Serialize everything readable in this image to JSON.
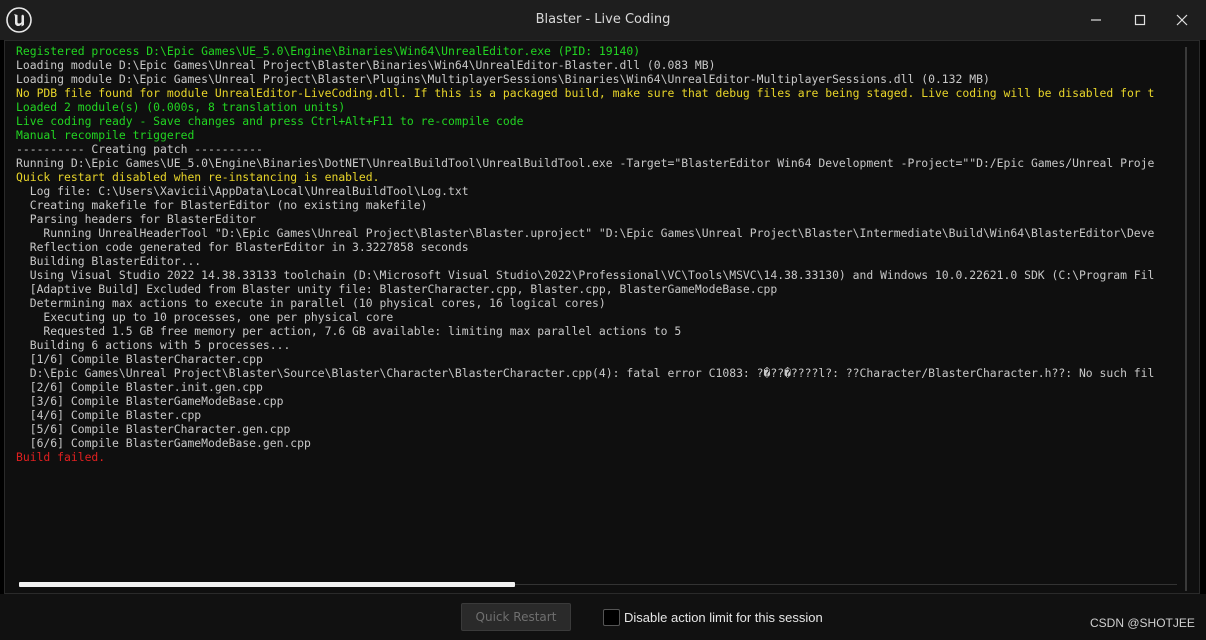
{
  "window": {
    "title": "Blaster - Live Coding"
  },
  "colors": {
    "green": "#22d422",
    "yellow": "#e8d52a",
    "gray": "#c8c8c8",
    "red": "#e02020"
  },
  "icons": {
    "logo": "unreal-engine-logo-icon",
    "minimize": "minimize-icon",
    "maximize": "maximize-icon",
    "close": "close-icon"
  },
  "console": {
    "lines": [
      {
        "text": "Registered process D:\\Epic Games\\UE_5.0\\Engine\\Binaries\\Win64\\UnrealEditor.exe (PID: 19140)",
        "color": "#22d422"
      },
      {
        "text": "Loading module D:\\Epic Games\\Unreal Project\\Blaster\\Binaries\\Win64\\UnrealEditor-Blaster.dll (0.083 MB)",
        "color": "#c8c8c8"
      },
      {
        "text": "Loading module D:\\Epic Games\\Unreal Project\\Blaster\\Plugins\\MultiplayerSessions\\Binaries\\Win64\\UnrealEditor-MultiplayerSessions.dll (0.132 MB)",
        "color": "#c8c8c8"
      },
      {
        "text": "No PDB file found for module UnrealEditor-LiveCoding.dll. If this is a packaged build, make sure that debug files are being staged. Live coding will be disabled for t",
        "color": "#e8d52a"
      },
      {
        "text": "Loaded 2 module(s) (0.000s, 8 translation units)",
        "color": "#22d422"
      },
      {
        "text": "Live coding ready - Save changes and press Ctrl+Alt+F11 to re-compile code",
        "color": "#22d422"
      },
      {
        "text": "Manual recompile triggered",
        "color": "#22d422"
      },
      {
        "text": "---------- Creating patch ----------",
        "color": "#c8c8c8"
      },
      {
        "text": "Running D:\\Epic Games\\UE_5.0\\Engine\\Binaries\\DotNET\\UnrealBuildTool\\UnrealBuildTool.exe -Target=\"BlasterEditor Win64 Development -Project=\"\"D:/Epic Games/Unreal Proje",
        "color": "#c8c8c8"
      },
      {
        "text": "Quick restart disabled when re-instancing is enabled.",
        "color": "#e8d52a"
      },
      {
        "text": "  Log file: C:\\Users\\Xavicii\\AppData\\Local\\UnrealBuildTool\\Log.txt",
        "color": "#c8c8c8"
      },
      {
        "text": "  Creating makefile for BlasterEditor (no existing makefile)",
        "color": "#c8c8c8"
      },
      {
        "text": "  Parsing headers for BlasterEditor",
        "color": "#c8c8c8"
      },
      {
        "text": "    Running UnrealHeaderTool \"D:\\Epic Games\\Unreal Project\\Blaster\\Blaster.uproject\" \"D:\\Epic Games\\Unreal Project\\Blaster\\Intermediate\\Build\\Win64\\BlasterEditor\\Deve",
        "color": "#c8c8c8"
      },
      {
        "text": "  Reflection code generated for BlasterEditor in 3.3227858 seconds",
        "color": "#c8c8c8"
      },
      {
        "text": "  Building BlasterEditor...",
        "color": "#c8c8c8"
      },
      {
        "text": "  Using Visual Studio 2022 14.38.33133 toolchain (D:\\Microsoft Visual Studio\\2022\\Professional\\VC\\Tools\\MSVC\\14.38.33130) and Windows 10.0.22621.0 SDK (C:\\Program Fil",
        "color": "#c8c8c8"
      },
      {
        "text": "  [Adaptive Build] Excluded from Blaster unity file: BlasterCharacter.cpp, Blaster.cpp, BlasterGameModeBase.cpp",
        "color": "#c8c8c8"
      },
      {
        "text": "  Determining max actions to execute in parallel (10 physical cores, 16 logical cores)",
        "color": "#c8c8c8"
      },
      {
        "text": "    Executing up to 10 processes, one per physical core",
        "color": "#c8c8c8"
      },
      {
        "text": "    Requested 1.5 GB free memory per action, 7.6 GB available: limiting max parallel actions to 5",
        "color": "#c8c8c8"
      },
      {
        "text": "  Building 6 actions with 5 processes...",
        "color": "#c8c8c8"
      },
      {
        "text": "  [1/6] Compile BlasterCharacter.cpp",
        "color": "#c8c8c8"
      },
      {
        "text": "  D:\\Epic Games\\Unreal Project\\Blaster\\Source\\Blaster\\Character\\BlasterCharacter.cpp(4): fatal error C1083: ?�??�????l?: ??Character/BlasterCharacter.h??: No such fil",
        "color": "#c8c8c8"
      },
      {
        "text": "  [2/6] Compile Blaster.init.gen.cpp",
        "color": "#c8c8c8"
      },
      {
        "text": "  [3/6] Compile BlasterGameModeBase.cpp",
        "color": "#c8c8c8"
      },
      {
        "text": "  [4/6] Compile Blaster.cpp",
        "color": "#c8c8c8"
      },
      {
        "text": "  [5/6] Compile BlasterCharacter.gen.cpp",
        "color": "#c8c8c8"
      },
      {
        "text": "  [6/6] Compile BlasterGameModeBase.gen.cpp",
        "color": "#c8c8c8"
      },
      {
        "text": "Build failed.",
        "color": "#e02020"
      }
    ]
  },
  "footer": {
    "quick_restart_label": "Quick Restart",
    "disable_action_limit_label": "Disable action limit for this session",
    "disable_action_limit_checked": false,
    "watermark": "CSDN @SHOTJEE"
  }
}
